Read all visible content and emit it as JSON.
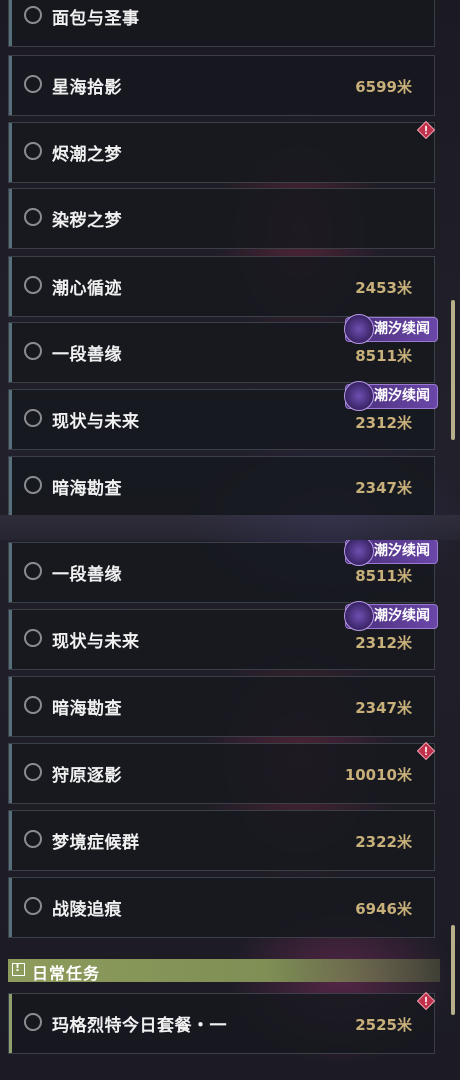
{
  "top_list": [
    {
      "name": "面包与圣事",
      "distance": "",
      "badge": ""
    },
    {
      "name": "星海拾影",
      "distance": "6599米",
      "badge": ""
    },
    {
      "name": "烬潮之梦",
      "distance": "",
      "badge": "warning"
    },
    {
      "name": "染秽之梦",
      "distance": "",
      "badge": ""
    },
    {
      "name": "潮心循迹",
      "distance": "2453米",
      "badge": ""
    },
    {
      "name": "一段善缘",
      "distance": "8511米",
      "badge": "tag",
      "tag": "潮汐续闻"
    },
    {
      "name": "现状与未来",
      "distance": "2312米",
      "badge": "tag",
      "tag": "潮汐续闻"
    },
    {
      "name": "暗海勘查",
      "distance": "2347米",
      "badge": ""
    }
  ],
  "bottom_list": [
    {
      "name": "一段善缘",
      "distance": "8511米",
      "badge": "tag",
      "tag": "潮汐续闻"
    },
    {
      "name": "现状与未来",
      "distance": "2312米",
      "badge": "tag",
      "tag": "潮汐续闻"
    },
    {
      "name": "暗海勘查",
      "distance": "2347米",
      "badge": ""
    },
    {
      "name": "狩原逐影",
      "distance": "10010米",
      "badge": "warning"
    },
    {
      "name": "梦境症候群",
      "distance": "2322米",
      "badge": ""
    },
    {
      "name": "战陵追痕",
      "distance": "6946米",
      "badge": ""
    }
  ],
  "daily_section": {
    "label": "日常任务"
  },
  "daily_list": [
    {
      "name": "玛格烈特今日套餐・一",
      "distance": "2525米",
      "badge": "warning"
    }
  ],
  "colors": {
    "distance": "#c8b07a",
    "tag_bg": "#5a3d94",
    "warning": "#c0304a",
    "section": "#8d9c5c"
  }
}
